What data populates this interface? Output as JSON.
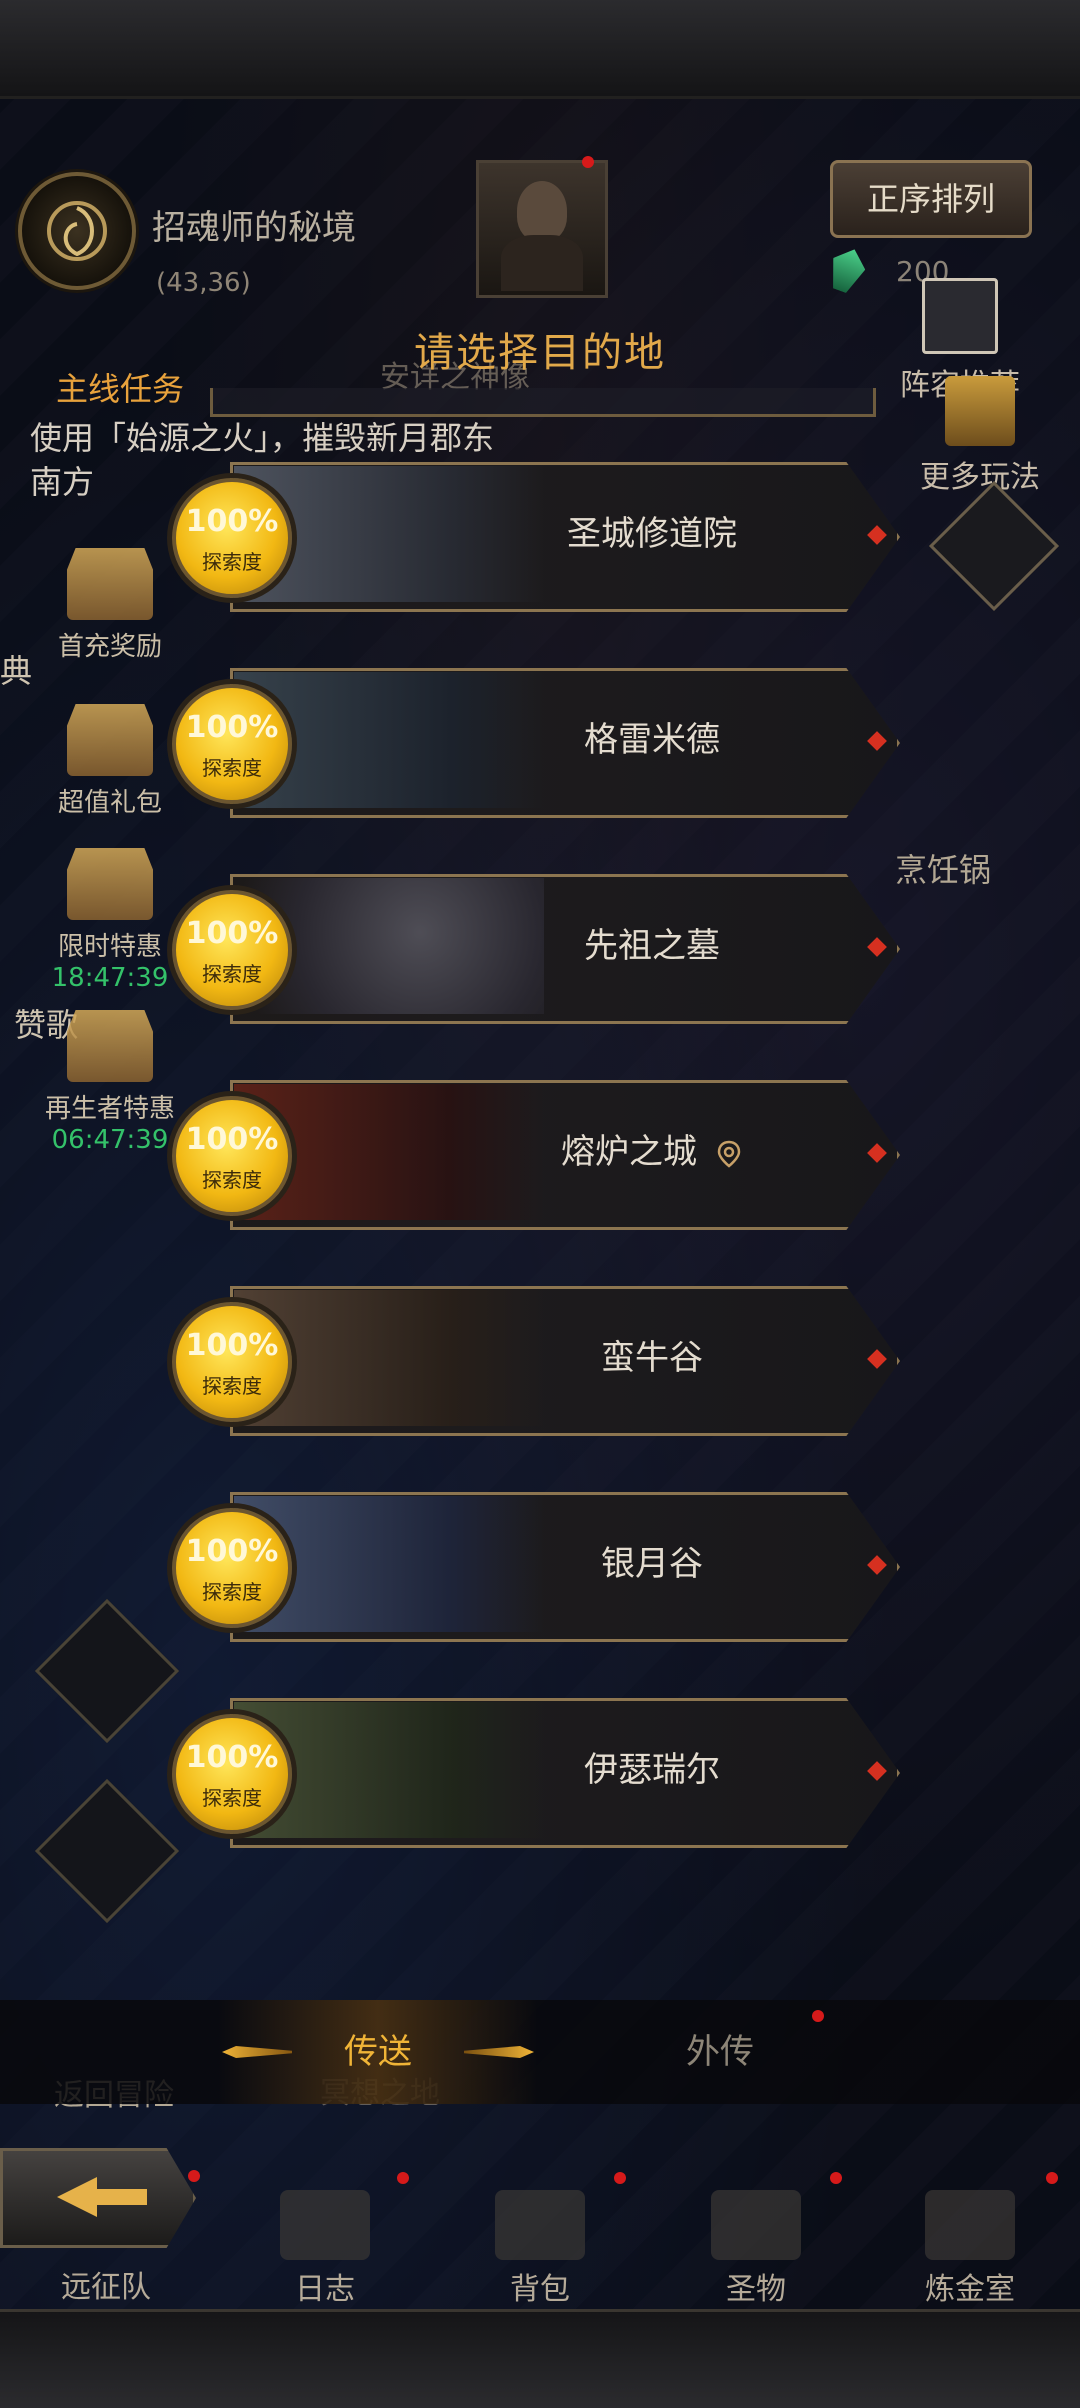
{
  "header": {
    "location_name": "招魂师的秘境",
    "coordinates": "(43,36)",
    "sort_button": "正序排列",
    "currency_count": "200"
  },
  "right_menu": {
    "formation": "阵容推荐",
    "more_play": "更多玩法",
    "cooking_pot": "烹饪锅"
  },
  "dialog": {
    "title": "请选择目的地",
    "ghost_top": "安详之神像",
    "ghost_bottom": "冥想之地"
  },
  "quest": {
    "title": "主线任务",
    "text": "使用「始源之火」，摧毁新月郡东南方"
  },
  "left_menu": {
    "edge_text_1": "典",
    "edge_text_2": "赞歌",
    "first_charge": "首充奖励",
    "value_pack": "超值礼包",
    "limited": "限时特惠",
    "limited_timer": "18:47:39",
    "reborn": "再生者特惠",
    "reborn_timer": "06:47:39",
    "return_adventure": "返回冒险"
  },
  "destinations": [
    {
      "name": "圣城修道院",
      "progress": "100%",
      "label": "探索度"
    },
    {
      "name": "格雷米德",
      "progress": "100%",
      "label": "探索度"
    },
    {
      "name": "先祖之墓",
      "progress": "100%",
      "label": "探索度"
    },
    {
      "name": "熔炉之城",
      "progress": "100%",
      "label": "探索度"
    },
    {
      "name": "蛮牛谷",
      "progress": "100%",
      "label": "探索度"
    },
    {
      "name": "银月谷",
      "progress": "100%",
      "label": "探索度"
    },
    {
      "name": "伊瑟瑞尔",
      "progress": "100%",
      "label": "探索度"
    }
  ],
  "tabs": {
    "active": "传送",
    "inactive": "外传"
  },
  "bottom_nav": {
    "expedition": "远征队",
    "journal": "日志",
    "bag": "背包",
    "relic": "圣物",
    "alchemy": "炼金室"
  }
}
